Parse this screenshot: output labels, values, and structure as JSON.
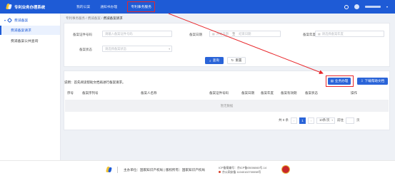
{
  "header": {
    "app_title": "专利业务办理系统",
    "nav": [
      {
        "label": "我的公案"
      },
      {
        "label": "通知书办理"
      },
      {
        "label": "专利事务服务"
      }
    ]
  },
  "sidebar": {
    "group_label": "费减备案",
    "items": [
      {
        "label": "费减备案请求"
      },
      {
        "label": "费减备案公共查询"
      }
    ]
  },
  "breadcrumb": {
    "items": [
      "专利事务服务",
      "费减备案",
      "费减备案请求"
    ],
    "separator": "/"
  },
  "filters": {
    "cert_number": {
      "label": "备案证件号码",
      "placeholder": "请输入备案证件号码"
    },
    "date": {
      "label": "备案日期",
      "start_placeholder": "开始日期",
      "sep": "至",
      "end_placeholder": "结束日期"
    },
    "year": {
      "label": "备案年度",
      "placeholder": "请选择备案年度"
    },
    "status": {
      "label": "备案状态",
      "placeholder": "请选择备案状态"
    },
    "query_label": "查询",
    "reset_label": "重置"
  },
  "table": {
    "notice": "说明：首先阅读帮助文档再进行备案请求。",
    "apply_label": "业务办理",
    "download_label": "下载帮助文档",
    "columns": [
      "序号",
      "备案序列号",
      "备案人名称",
      "备案证件号码",
      "备案日期",
      "备案年度",
      "备案有效期",
      "备案状态",
      "操作"
    ],
    "empty_text": "暂无数据"
  },
  "pager": {
    "total": "共 0 条",
    "current_page": "1",
    "page_size": "10条/页",
    "goto_label": "前往",
    "page_unit": "页"
  },
  "footer": {
    "sponsor": "主办单位：国家知识产权局 | 版权所有：国家知识产权局",
    "icp": "ICP备案编号：京ICP备05006060号-14",
    "police": "京公网安备 11040102700098号"
  },
  "colors": {
    "brand_blue": "#1e5bd6",
    "highlight_red": "#e8262a",
    "primary_button": "#2a64d8"
  }
}
